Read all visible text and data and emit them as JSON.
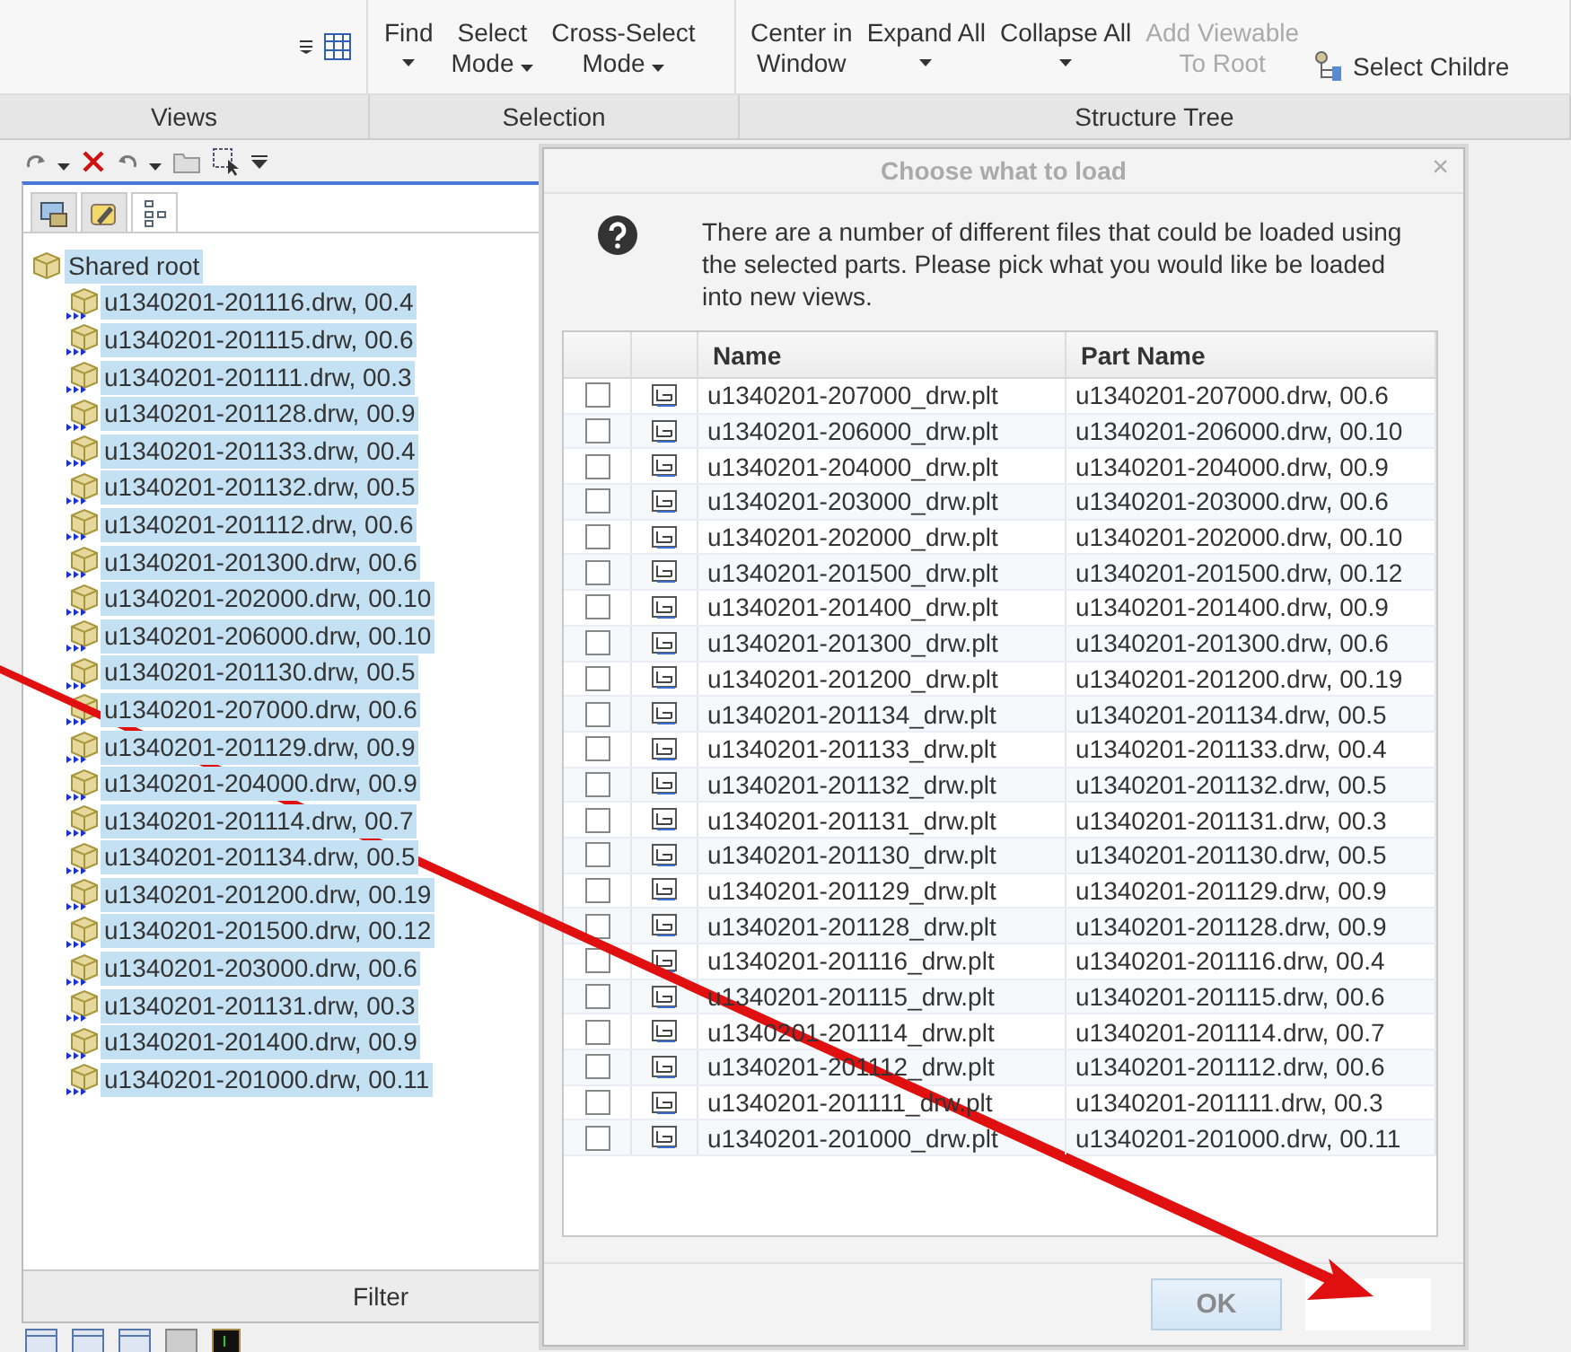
{
  "ribbon": {
    "groups": [
      {
        "label": "Views"
      },
      {
        "label": "Selection",
        "buttons": [
          {
            "lines": [
              "Find"
            ],
            "caret": true,
            "disabled": false
          },
          {
            "lines": [
              "Select",
              "Mode"
            ],
            "caret": true,
            "disabled": false
          },
          {
            "lines": [
              "Cross-Select",
              "Mode"
            ],
            "caret": true,
            "disabled": false
          }
        ]
      },
      {
        "label": "Structure Tree",
        "buttons": [
          {
            "lines": [
              "Center in",
              "Window"
            ],
            "caret": false,
            "disabled": false
          },
          {
            "lines": [
              "Expand All"
            ],
            "caret": true,
            "disabled": false
          },
          {
            "lines": [
              "Collapse All"
            ],
            "caret": true,
            "disabled": false
          },
          {
            "lines": [
              "Add Viewable",
              "To Root"
            ],
            "caret": false,
            "disabled": true
          }
        ]
      }
    ],
    "select_children": "Select Childre"
  },
  "tree_panel": {
    "tabs": [
      {
        "kind": "views",
        "selected": false
      },
      {
        "kind": "edit",
        "selected": false
      },
      {
        "kind": "tree",
        "selected": true
      }
    ],
    "root": {
      "label": "Shared root",
      "selected": true,
      "children": [
        {
          "label": "u1340201-201116.drw, 00.4",
          "selected": true
        },
        {
          "label": "u1340201-201115.drw, 00.6",
          "selected": true
        },
        {
          "label": "u1340201-201111.drw, 00.3",
          "selected": true
        },
        {
          "label": "u1340201-201128.drw, 00.9",
          "selected": true
        },
        {
          "label": "u1340201-201133.drw, 00.4",
          "selected": true
        },
        {
          "label": "u1340201-201132.drw, 00.5",
          "selected": true
        },
        {
          "label": "u1340201-201112.drw, 00.6",
          "selected": true
        },
        {
          "label": "u1340201-201300.drw, 00.6",
          "selected": true
        },
        {
          "label": "u1340201-202000.drw, 00.10",
          "selected": true
        },
        {
          "label": "u1340201-206000.drw, 00.10",
          "selected": true
        },
        {
          "label": "u1340201-201130.drw, 00.5",
          "selected": true
        },
        {
          "label": "u1340201-207000.drw, 00.6",
          "selected": true
        },
        {
          "label": "u1340201-201129.drw, 00.9",
          "selected": true
        },
        {
          "label": "u1340201-204000.drw, 00.9",
          "selected": true
        },
        {
          "label": "u1340201-201114.drw, 00.7",
          "selected": true
        },
        {
          "label": "u1340201-201134.drw, 00.5",
          "selected": true
        },
        {
          "label": "u1340201-201200.drw, 00.19",
          "selected": true
        },
        {
          "label": "u1340201-201500.drw, 00.12",
          "selected": true
        },
        {
          "label": "u1340201-203000.drw, 00.6",
          "selected": true
        },
        {
          "label": "u1340201-201131.drw, 00.3",
          "selected": true
        },
        {
          "label": "u1340201-201400.drw, 00.9",
          "selected": true
        },
        {
          "label": "u1340201-201000.drw, 00.11",
          "selected": true
        }
      ]
    },
    "filter": "Filter"
  },
  "dialog": {
    "title": "Choose what to load",
    "close": "×",
    "message": "There are a number of different files that could be loaded using the selected parts.  Please pick what you would like be loaded into new views.",
    "columns": [
      "Name",
      "Part Name"
    ],
    "rows": [
      {
        "checked": false,
        "name": "u1340201-207000_drw.plt",
        "part": "u1340201-207000.drw, 00.6"
      },
      {
        "checked": false,
        "name": "u1340201-206000_drw.plt",
        "part": "u1340201-206000.drw, 00.10"
      },
      {
        "checked": false,
        "name": "u1340201-204000_drw.plt",
        "part": "u1340201-204000.drw, 00.9"
      },
      {
        "checked": false,
        "name": "u1340201-203000_drw.plt",
        "part": "u1340201-203000.drw, 00.6"
      },
      {
        "checked": false,
        "name": "u1340201-202000_drw.plt",
        "part": "u1340201-202000.drw, 00.10"
      },
      {
        "checked": false,
        "name": "u1340201-201500_drw.plt",
        "part": "u1340201-201500.drw, 00.12"
      },
      {
        "checked": false,
        "name": "u1340201-201400_drw.plt",
        "part": "u1340201-201400.drw, 00.9"
      },
      {
        "checked": false,
        "name": "u1340201-201300_drw.plt",
        "part": "u1340201-201300.drw, 00.6"
      },
      {
        "checked": false,
        "name": "u1340201-201200_drw.plt",
        "part": "u1340201-201200.drw, 00.19"
      },
      {
        "checked": false,
        "name": "u1340201-201134_drw.plt",
        "part": "u1340201-201134.drw, 00.5"
      },
      {
        "checked": false,
        "name": "u1340201-201133_drw.plt",
        "part": "u1340201-201133.drw, 00.4"
      },
      {
        "checked": false,
        "name": "u1340201-201132_drw.plt",
        "part": "u1340201-201132.drw, 00.5"
      },
      {
        "checked": false,
        "name": "u1340201-201131_drw.plt",
        "part": "u1340201-201131.drw, 00.3"
      },
      {
        "checked": false,
        "name": "u1340201-201130_drw.plt",
        "part": "u1340201-201130.drw, 00.5"
      },
      {
        "checked": false,
        "name": "u1340201-201129_drw.plt",
        "part": "u1340201-201129.drw, 00.9"
      },
      {
        "checked": false,
        "name": "u1340201-201128_drw.plt",
        "part": "u1340201-201128.drw, 00.9"
      },
      {
        "checked": false,
        "name": "u1340201-201116_drw.plt",
        "part": "u1340201-201116.drw, 00.4"
      },
      {
        "checked": false,
        "name": "u1340201-201115_drw.plt",
        "part": "u1340201-201115.drw, 00.6"
      },
      {
        "checked": false,
        "name": "u1340201-201114_drw.plt",
        "part": "u1340201-201114.drw, 00.7"
      },
      {
        "checked": false,
        "name": "u1340201-201112_drw.plt",
        "part": "u1340201-201112.drw, 00.6"
      },
      {
        "checked": false,
        "name": "u1340201-201111_drw.plt",
        "part": "u1340201-201111.drw, 00.3"
      },
      {
        "checked": false,
        "name": "u1340201-201000_drw.plt",
        "part": "u1340201-201000.drw, 00.11"
      }
    ],
    "ok": {
      "label": "OK",
      "disabled": true
    }
  }
}
